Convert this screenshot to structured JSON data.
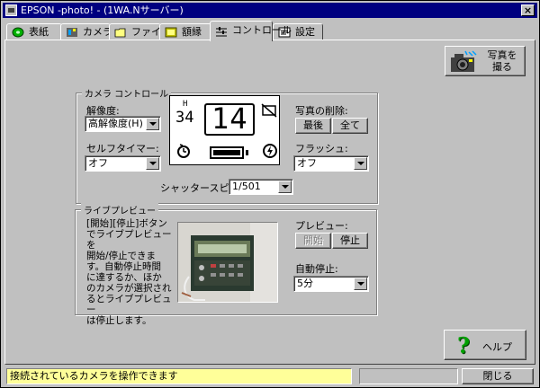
{
  "window": {
    "title": "EPSON -photo! - (1WA.Nサーバー)",
    "close_glyph": "×"
  },
  "tabs": [
    {
      "label": "表紙",
      "icon": "disc-icon"
    },
    {
      "label": "カメラ",
      "icon": "camera-icon"
    },
    {
      "label": "ファイル",
      "icon": "folder-icon"
    },
    {
      "label": "額縁",
      "icon": "frame-icon"
    },
    {
      "label": "コントロール",
      "icon": "control-icon",
      "active": true
    },
    {
      "label": "設定",
      "icon": "settings-icon"
    }
  ],
  "shoot_button": {
    "label_line1": "写真を",
    "label_line2": "撮る"
  },
  "camera_control": {
    "group_label": "カメラ コントロール",
    "resolution_label": "解像度:",
    "resolution_value": "高解像度(H)",
    "self_timer_label": "セルフタイマー:",
    "self_timer_value": "オフ",
    "delete_label": "写真の削除:",
    "delete_last": "最後",
    "delete_all": "全て",
    "flash_label": "フラッシュ:",
    "flash_value": "オフ",
    "shutter_label": "シャッタースピード:",
    "shutter_value": "1/501",
    "lcd": {
      "small_top": "H",
      "small_num": "34",
      "big_num": "14"
    }
  },
  "live_preview": {
    "group_label": "ライブプレビュー",
    "description_lines": [
      "[開始][停止]ボタン",
      "でライブプレビューを",
      "開始/停止できま",
      "す。自動停止時間",
      "に達するか、ほか",
      "のカメラが選択され",
      "るとライブプレビュー",
      "は停止します。"
    ],
    "preview_label": "プレビュー:",
    "start_button": "開始",
    "stop_button": "停止",
    "auto_stop_label": "自動停止:",
    "auto_stop_value": "5分"
  },
  "help_button": {
    "label": "ヘルプ",
    "icon": "help-icon"
  },
  "status": {
    "message": "接続されているカメラを操作できます",
    "close_button": "閉じる"
  },
  "colors": {
    "title_bar": "#000080",
    "status_highlight": "#ffff99",
    "help_green": "#00a000"
  }
}
